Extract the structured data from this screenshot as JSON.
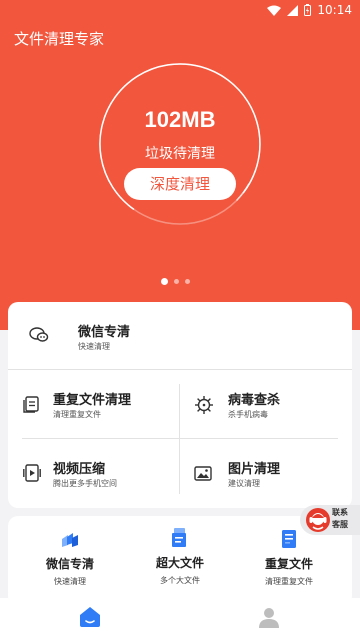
{
  "status_bar": {
    "time": "10:14"
  },
  "app": {
    "title": "文件清理专家"
  },
  "hero": {
    "size": "102MB",
    "status": "垃圾待清理",
    "button_label": "深度清理",
    "carousel": {
      "count": 3,
      "active": 0
    }
  },
  "features": {
    "wechat": {
      "title": "微信专清",
      "subtitle": "快速清理",
      "icon": "wechat-icon"
    },
    "duplicate": {
      "title": "重复文件清理",
      "subtitle": "清理重复文件",
      "icon": "document-icon"
    },
    "virus": {
      "title": "病毒查杀",
      "subtitle": "杀手机病毒",
      "icon": "virus-icon"
    },
    "video": {
      "title": "视频压缩",
      "subtitle": "腾出更多手机空间",
      "icon": "video-icon"
    },
    "image": {
      "title": "图片清理",
      "subtitle": "建议清理",
      "icon": "image-icon"
    }
  },
  "quick": [
    {
      "title": "微信专清",
      "subtitle": "快速清理",
      "icon": "wechat-clean-icon"
    },
    {
      "title": "超大文件",
      "subtitle": "多个大文件",
      "icon": "large-file-icon"
    },
    {
      "title": "重复文件",
      "subtitle": "清理重复文件",
      "icon": "duplicate-file-icon"
    }
  ],
  "contact": {
    "label": "联系客服"
  },
  "tabs": [
    {
      "icon": "home-icon",
      "active": true
    },
    {
      "icon": "profile-icon",
      "active": false
    }
  ],
  "colors": {
    "accent": "#f2563d",
    "icon_blue": "#2f7cf6"
  }
}
